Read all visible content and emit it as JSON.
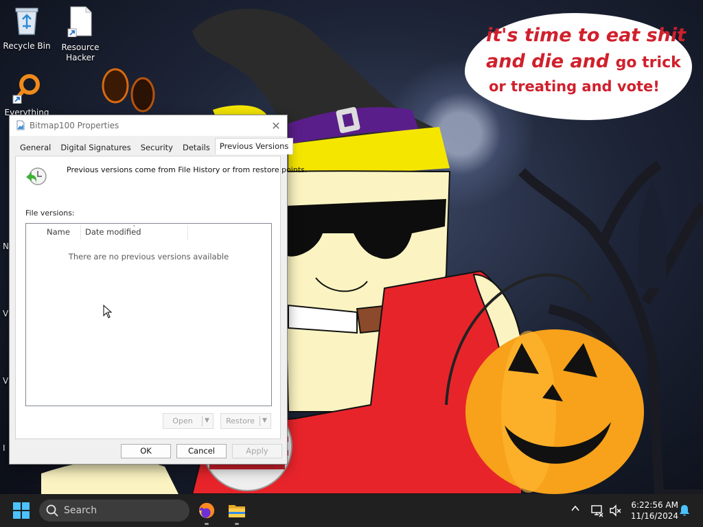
{
  "desktop": {
    "icons": [
      {
        "label": "Recycle Bin",
        "icon": "recycle-bin-icon"
      },
      {
        "label": "Resource Hacker",
        "icon": "document-shortcut-icon"
      },
      {
        "label": "Everything",
        "icon": "everything-search-icon"
      }
    ],
    "edge_letters": [
      "N",
      "V",
      "Vi",
      "I"
    ],
    "bubble": {
      "line1": "it's time to eat shit",
      "line2a": "and die and",
      "line2b": "go trick",
      "line3": "or treating and vote!"
    }
  },
  "window": {
    "title": "Bitmap100 Properties",
    "close_label": "✕",
    "tabs": [
      {
        "label": "General"
      },
      {
        "label": "Digital Signatures"
      },
      {
        "label": "Security"
      },
      {
        "label": "Details"
      },
      {
        "label": "Previous Versions",
        "active": true
      }
    ],
    "intro": "Previous versions come from File History or from restore points.",
    "file_versions_label": "File versions:",
    "columns": [
      "Name",
      "Date modified"
    ],
    "empty_message": "There are no previous versions available",
    "open_label": "Open",
    "restore_label": "Restore",
    "ok_label": "OK",
    "cancel_label": "Cancel",
    "apply_label": "Apply"
  },
  "taskbar": {
    "search_placeholder": "Search",
    "pinned": [
      "firefox-icon",
      "file-explorer-icon"
    ],
    "time": "6:22:56 AM",
    "date": "11/16/2024"
  },
  "colors": {
    "bubble_text": "#d0202c",
    "taskbar": "#202020",
    "window_bg": "#f0f0f0",
    "start_blue": "#4cc2ff"
  }
}
